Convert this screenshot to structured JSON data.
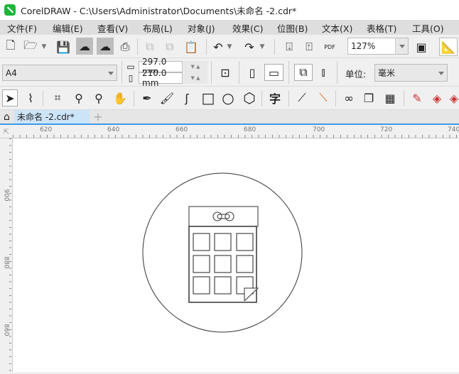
{
  "title": "CorelDRAW - C:\\Users\\Administrator\\Documents\\未命名 -2.cdr*",
  "menu": [
    "文件(F)",
    "编辑(E)",
    "查看(V)",
    "布局(L)",
    "对象(J)",
    "效果(C)",
    "位图(B)",
    "文本(X)",
    "表格(T)",
    "工具(O)"
  ],
  "toolbar": {
    "zoom": "127%",
    "pdf_label": "PDF"
  },
  "property_bar": {
    "page_size": "A4",
    "width": "297.0 mm",
    "height": "210.0 mm",
    "unit_label": "单位:",
    "unit": "毫米"
  },
  "toolbox": {
    "text_tool": "字"
  },
  "doc_tab": {
    "name": "未命名 -2.cdr*",
    "add": "+"
  },
  "ruler": {
    "h_ticks": [
      "620",
      "640",
      "660",
      "680",
      "700",
      "720",
      "740"
    ],
    "v_ticks": [
      "900",
      "880",
      "860"
    ]
  }
}
